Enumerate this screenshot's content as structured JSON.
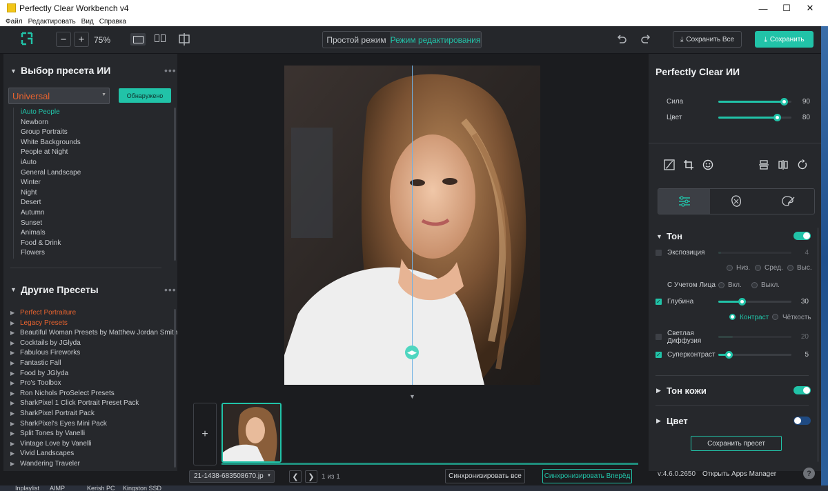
{
  "window": {
    "title": "Perfectly Clear Workbench v4"
  },
  "menu": [
    "Файл",
    "Редактировать",
    "Вид",
    "Справка"
  ],
  "toolbar": {
    "zoom": "75%",
    "mode_simple": "Простой режим",
    "mode_edit": "Режим редактирования",
    "save_all": "Сохранить Все",
    "save": "Сохранить"
  },
  "left": {
    "ai_title": "Выбор пресета ИИ",
    "preset_value": "Universal",
    "detected": "Обнаружено",
    "ai_presets": [
      "iAuto People",
      "Newborn",
      "Group Portraits",
      "White Backgrounds",
      "People at Night",
      "iAuto",
      "General Landscape",
      "Winter",
      "Night",
      "Desert",
      "Autumn",
      "Sunset",
      "Animals",
      "Food & Drink",
      "Flowers"
    ],
    "other_title": "Другие Пресеты",
    "other_presets": [
      "Perfect Portraiture",
      "Legacy Presets",
      "Beautiful Woman Presets by Matthew Jordan Smith",
      "Cocktails by JGlyda",
      "Fabulous Fireworks",
      "Fantastic Fall",
      "Food by JGlyda",
      "Pro's Toolbox",
      "Ron Nichols ProSelect Presets",
      "SharkPixel 1 Click Portrait Preset Pack",
      "SharkPixel Portrait Pack",
      "SharkPixel's Eyes Mini Pack",
      "Split Tones by Vanelli",
      "Vintage Love by Vanelli",
      "Vivid Landscapes",
      "Wandering Traveler"
    ]
  },
  "center": {
    "filename": "21-1438-683508670.jp",
    "page": "1 из 1",
    "sync_all": "Синхронизировать все",
    "sync_fwd": "Синхронизировать Вперёд"
  },
  "right": {
    "title": "Perfectly Clear ИИ",
    "strength_label": "Сила",
    "strength": 90,
    "color_label": "Цвет",
    "color": 80,
    "tone": "Тон",
    "exposure_label": "Экспозиция",
    "exposure": 4,
    "low": "Низ.",
    "mid": "Сред.",
    "high": "Выс.",
    "face_label": "С Учетом Лица",
    "on": "Вкл.",
    "off": "Выкл.",
    "depth_label": "Глубина",
    "depth": 30,
    "contrast": "Контраст",
    "sharpness": "Чёткость",
    "diffusion_label": "Светлая Диффузия",
    "diffusion": 20,
    "supercontrast_label": "Суперконтраст",
    "supercontrast": 5,
    "skin_tone": "Тон кожи",
    "color_section": "Цвет",
    "save_preset": "Сохранить пресет",
    "version": "v:4.6.0.2650",
    "apps_manager": "Открыть Apps Manager",
    "help": "?"
  },
  "taskbar": [
    "Inplaylist",
    "AIMP",
    "Kerish PC",
    "Kingston SSD"
  ],
  "colors": {
    "accent": "#21c3a8",
    "orange": "#e8632f"
  }
}
